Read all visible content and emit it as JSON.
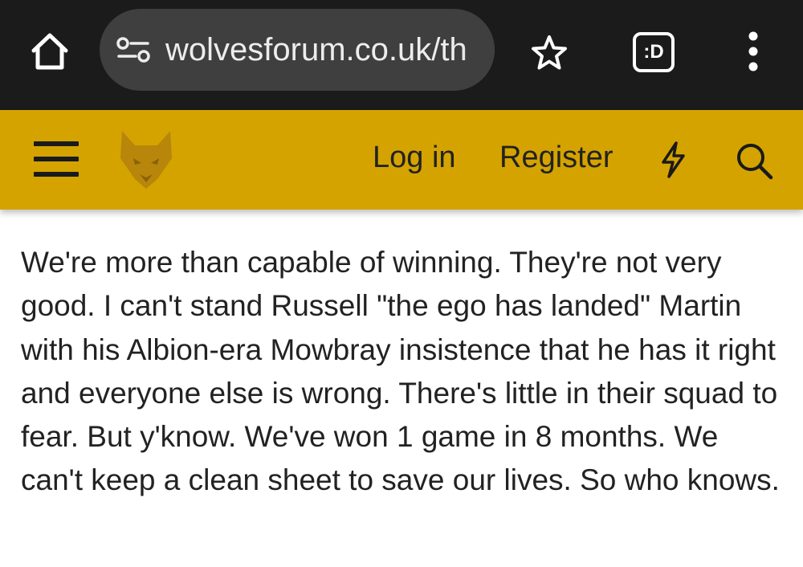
{
  "browser": {
    "url": "wolvesforum.co.uk/th",
    "tab_switcher_label": ":D",
    "icons": [
      "home-icon",
      "site-settings-icon",
      "star-icon",
      "tab-switcher-icon",
      "more-vert-icon"
    ]
  },
  "header": {
    "login_label": "Log in",
    "register_label": "Register",
    "background_color": "#d4a300",
    "logo": "wolf-head-logo",
    "icons": [
      "hamburger-menu-icon",
      "lightning-bolt-icon",
      "search-icon"
    ]
  },
  "post": {
    "body": "We're more than capable of winning. They're not very good. I can't stand Russell \"the ego has landed\" Martin with his Albion-era Mowbray insistence that he has it right and everyone else is wrong. There's little in their squad to fear. But y'know. We've won 1 game in 8 months. We can't keep a clean sheet to save our lives. So who knows."
  }
}
